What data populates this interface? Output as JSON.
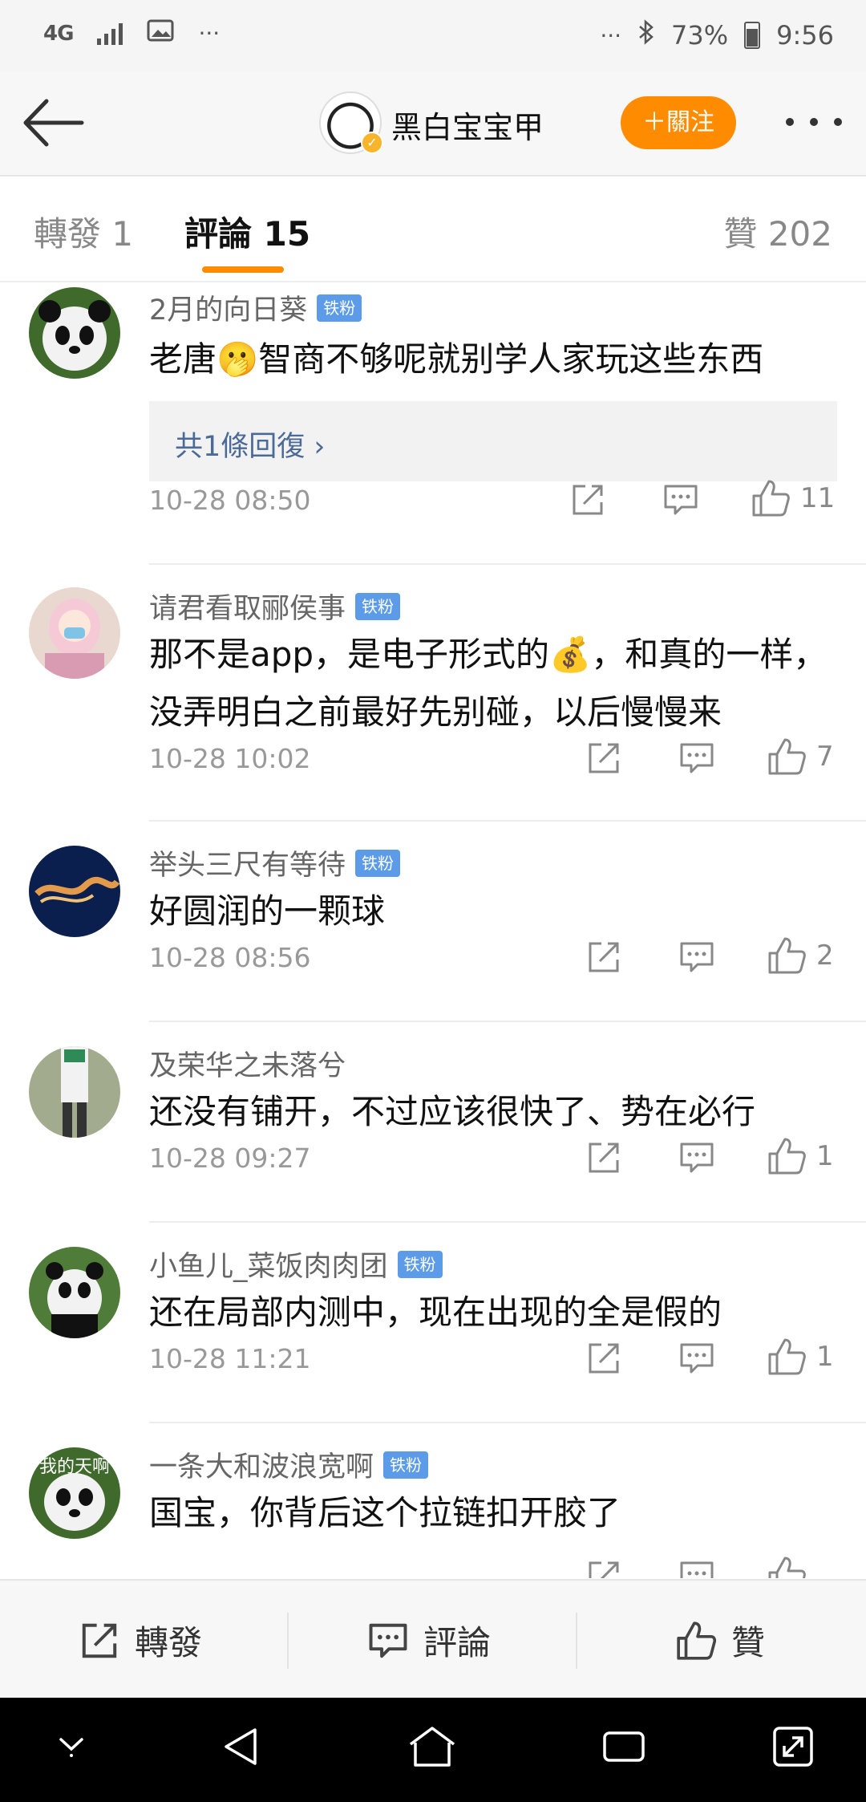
{
  "status_bar": {
    "network": "4G",
    "ellipsis_left": "···",
    "ellipsis_right": "···",
    "battery": "73%",
    "time": "9:56"
  },
  "header": {
    "username": "黑白宝宝甲",
    "follow_label": "＋關注"
  },
  "tabs": {
    "repost": "轉發 1",
    "comments": "評論 15",
    "likes": "贊 202"
  },
  "comments": [
    {
      "name": "2月的向日葵",
      "badge": "铁粉",
      "text": "老唐🫢智商不够呢就别学人家玩这些东西",
      "reply": "共1條回復 ›",
      "time": "10-28 08:50",
      "likes": "11"
    },
    {
      "name": "请君看取郦侯事",
      "badge": "铁粉",
      "text": "那不是app，是电子形式的💰，和真的一样，没弄明白之前最好先别碰，以后慢慢来",
      "time": "10-28 10:02",
      "likes": "7"
    },
    {
      "name": "举头三尺有等待",
      "badge": "铁粉",
      "text": "好圆润的一颗球",
      "time": "10-28 08:56",
      "likes": "2"
    },
    {
      "name": "及荣华之未落兮",
      "badge": "",
      "text": "还没有铺开，不过应该很快了、势在必行",
      "time": "10-28 09:27",
      "likes": "1"
    },
    {
      "name": "小鱼儿_菜饭肉肉团",
      "badge": "铁粉",
      "text": "还在局部内测中，现在出现的全是假的",
      "time": "10-28 11:21",
      "likes": "1"
    },
    {
      "name": "一条大和波浪宽啊",
      "badge": "铁粉",
      "text": "国宝，你背后这个拉链扣开胶了",
      "avatar_text": "我的天啊"
    }
  ],
  "bottom_bar": {
    "repost": "轉發",
    "comment": "評論",
    "like": "贊"
  },
  "colors": {
    "accent": "#ff8c00",
    "badge": "#5b9be8",
    "link": "#4c6a96"
  }
}
